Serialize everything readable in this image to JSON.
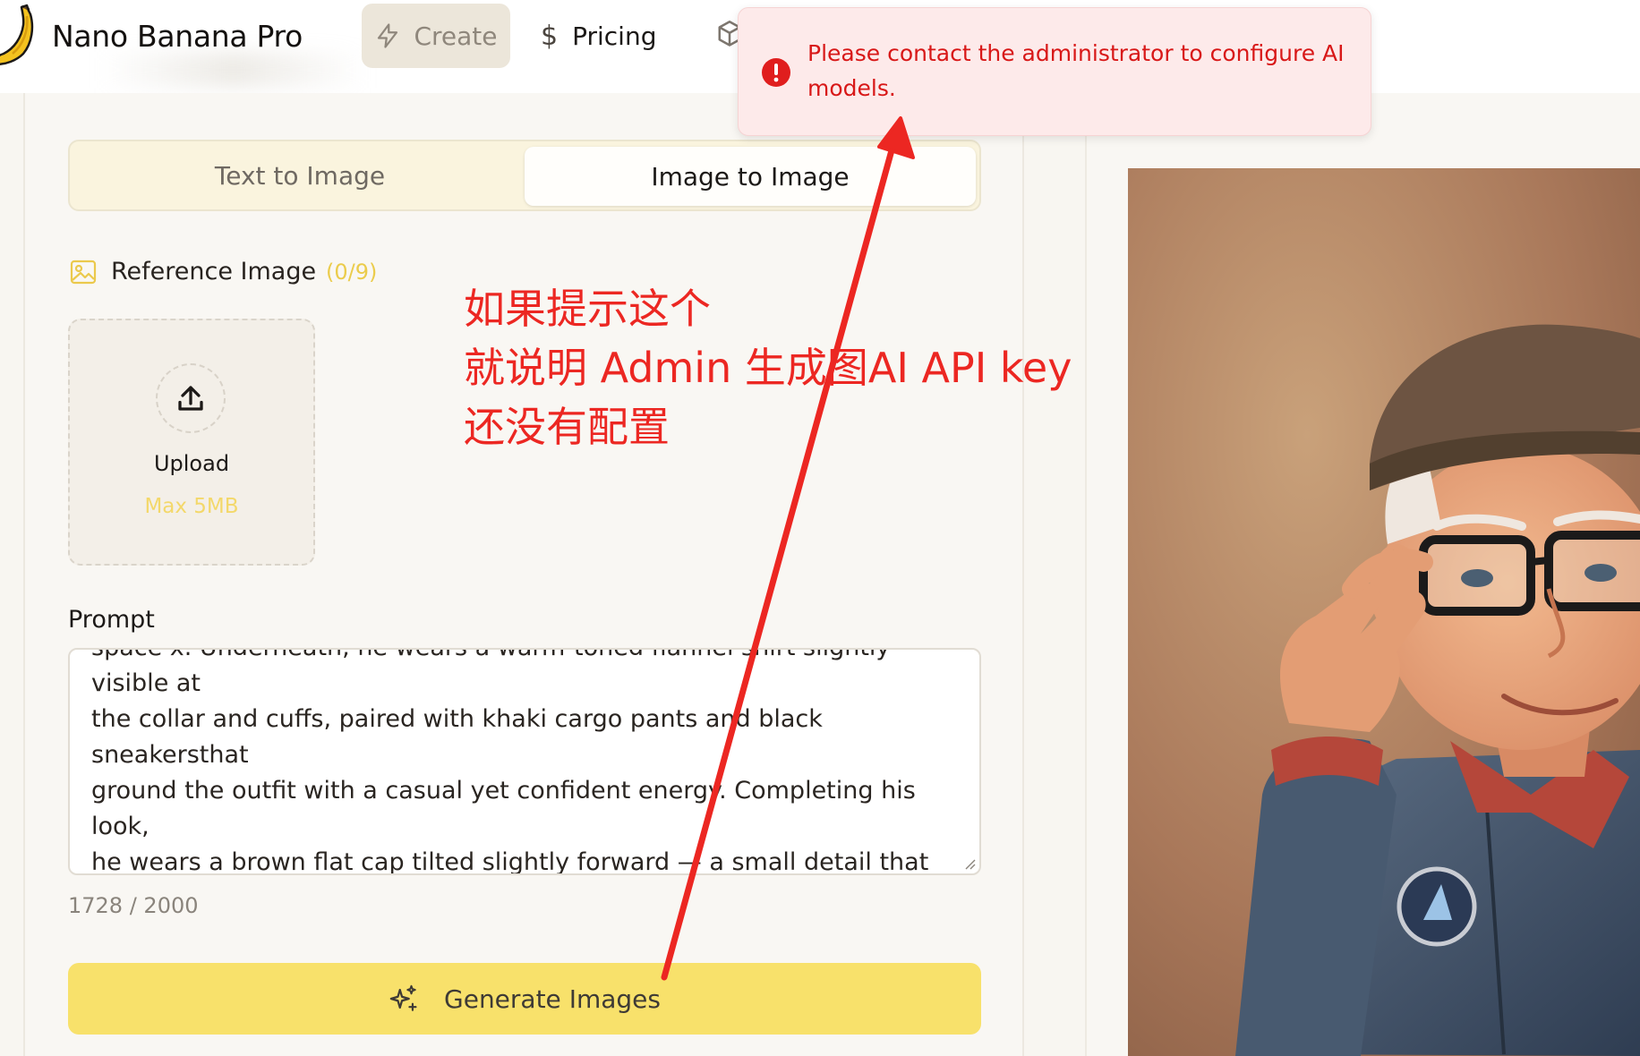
{
  "header": {
    "brand": "Nano Banana Pro",
    "nav": {
      "create": "Create",
      "pricing": "Pricing"
    }
  },
  "mode_tabs": {
    "text_to_image": "Text to Image",
    "image_to_image": "Image to Image",
    "selected": "Image to Image"
  },
  "reference": {
    "label": "Reference Image",
    "count": "(0/9)",
    "upload_label": "Upload",
    "upload_hint": "Max 5MB"
  },
  "prompt": {
    "label": "Prompt",
    "value": "space x. Underneath, he wears a warm-toned flannel shirt slightly visible at\nthe collar and cuffs, paired with khaki cargo pants and black sneakersthat\nground the outfit with a casual yet confident energy. Completing his look,\nhe wears a brown flat cap tilted slightly forward — a small detail that adds\npersonality and flair.The man is portrayed in a mid - shot,adjusting his\nglasses with one handwhile gazing directly at the viewer with a self -\nassured and composed expression.His head is slightly larger than",
    "char_count": "1728 / 2000"
  },
  "generate_button": "Generate Images",
  "toast": {
    "message": "Please contact the administrator to configure AI models.",
    "type": "error"
  },
  "annotation": {
    "line1": "如果提示这个",
    "line2": "就说明 Admin 生成图AI API key",
    "line3": "还没有配置"
  },
  "colors": {
    "accent_yellow": "#f8e16b",
    "error_red": "#d81818",
    "annotation_red": "#ec2722"
  }
}
